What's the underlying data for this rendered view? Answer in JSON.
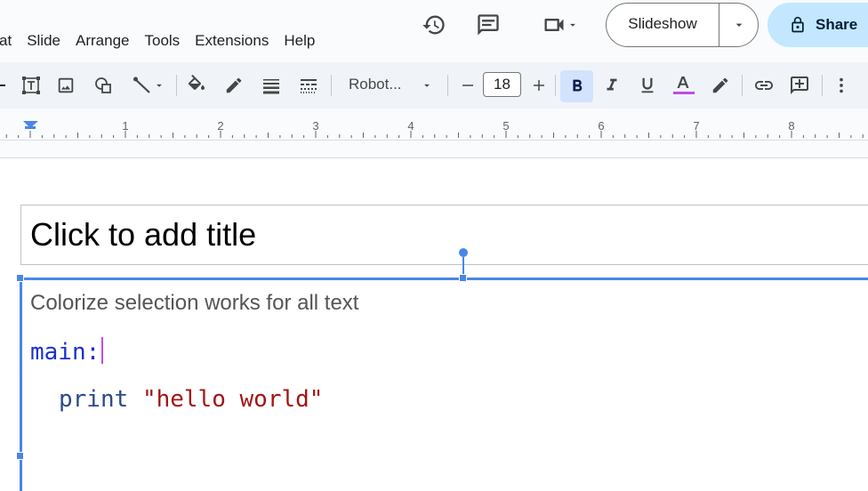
{
  "menu": [
    "at",
    "Slide",
    "Arrange",
    "Tools",
    "Extensions",
    "Help"
  ],
  "header": {
    "slideshow_label": "Slideshow",
    "share_label": "Share"
  },
  "toolbar": {
    "font_name": "Robot...",
    "font_size": "18",
    "text_color": "#c04ce8"
  },
  "ruler": {
    "marks": [
      "1",
      "2",
      "3",
      "4",
      "5",
      "6",
      "7",
      "8"
    ]
  },
  "slide": {
    "title_placeholder": "Click to add title",
    "body_text": "Colorize selection works for all text",
    "code_line1": "main:",
    "code_line2_keyword": "print",
    "code_line2_string": "\"hello world\""
  },
  "colors": {
    "accent": "#4a86e8",
    "keyword_blue": "#1a2fd0",
    "keyword_print": "#2b4a8c",
    "string_red": "#a31515",
    "share_bg": "#c2e7ff"
  }
}
